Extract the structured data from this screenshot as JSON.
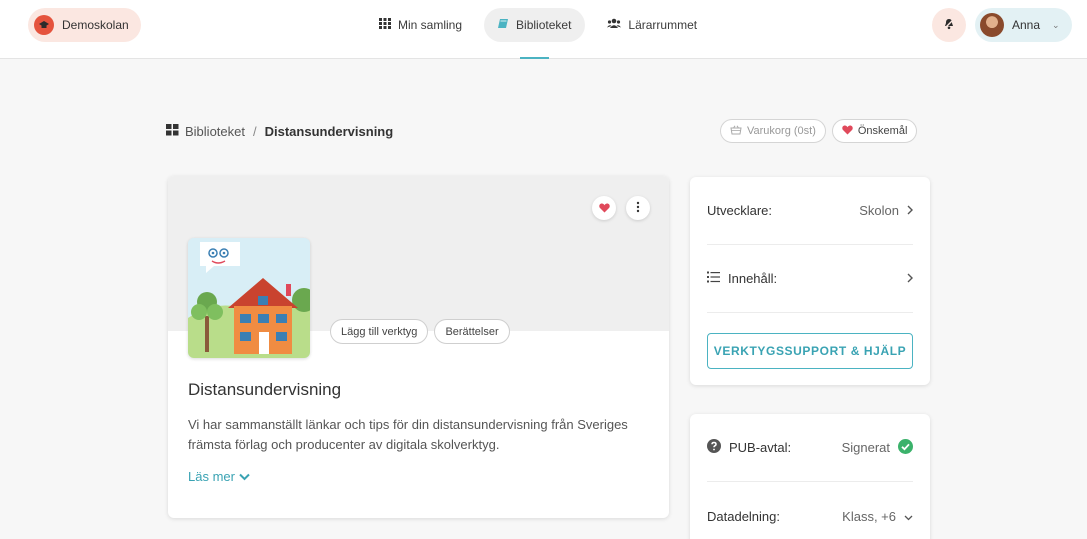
{
  "header": {
    "school_name": "Demoskolan",
    "nav": [
      {
        "label": "Min samling",
        "icon": "grid-icon",
        "active": false
      },
      {
        "label": "Biblioteket",
        "icon": "book-icon",
        "active": true
      },
      {
        "label": "Lärarrummet",
        "icon": "users-icon",
        "active": false
      }
    ],
    "user_name": "Anna"
  },
  "breadcrumb": {
    "root": "Biblioteket",
    "separator": "/",
    "current": "Distansundervisning"
  },
  "actions": {
    "cart_label": "Varukorg (0st)",
    "wishlist_label": "Önskemål"
  },
  "product": {
    "tags": [
      "Lägg till verktyg",
      "Berättelser"
    ],
    "title": "Distansundervisning",
    "description": "Vi har sammanställt länkar och tips för din distansundervisning från Sveriges främsta förlag och producenter av digitala skolverktyg.",
    "read_more": "Läs mer"
  },
  "info_panel": {
    "developer_label": "Utvecklare:",
    "developer_value": "Skolon",
    "content_label": "Innehåll:",
    "support_button": "VERKTYGSSUPPORT & HJÄLP"
  },
  "agreement_panel": {
    "pub_label": "PUB-avtal:",
    "pub_value": "Signerat",
    "sharing_label": "Datadelning:",
    "sharing_value": "Klass, +6"
  },
  "colors": {
    "accent": "#4bb3c2",
    "heart": "#e0495b",
    "success": "#3bb26b"
  }
}
